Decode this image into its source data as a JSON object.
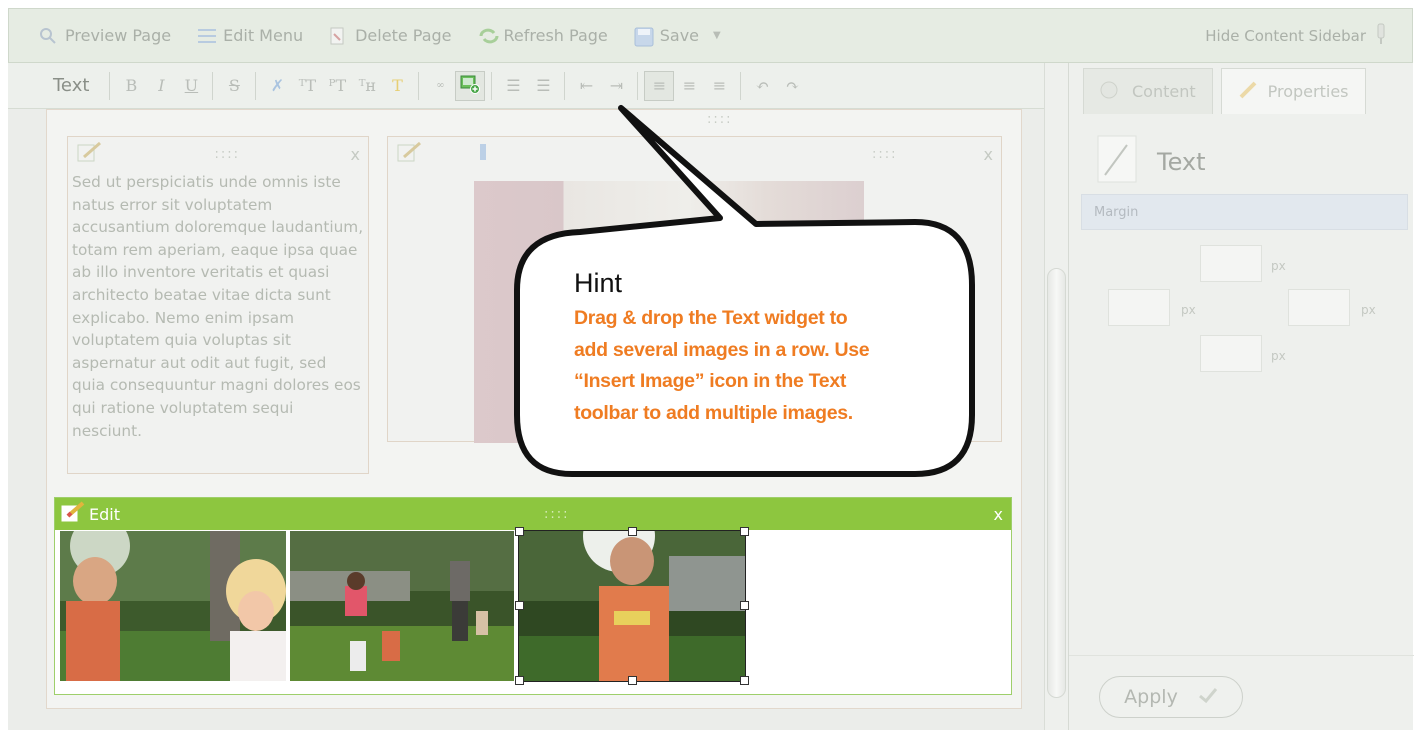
{
  "toolbar": {
    "preview_label": "Preview Page",
    "edit_menu_label": "Edit Menu",
    "delete_label": "Delete Page",
    "refresh_label": "Refresh Page",
    "save_label": "Save",
    "hide_sidebar_label": "Hide Content Sidebar"
  },
  "editor_toolbar": {
    "mode_label": "Text",
    "bold": "B",
    "italic": "I",
    "underline": "U",
    "strike": "S"
  },
  "widgets": {
    "text_widget_lorem": "Sed ut perspiciatis unde omnis iste natus error sit voluptatem accusantium doloremque laudantium, totam rem aperiam, eaque ipsa quae ab illo inventore veritatis et quasi architecto beatae vitae dicta sunt explicabo. Nemo enim ipsam voluptatem quia voluptas sit aspernatur aut odit aut fugit, sed quia consequuntur magni dolores eos qui ratione voluptatem sequi nesciunt.",
    "edit_label": "Edit",
    "close_glyph": "x",
    "drag_dots": "::::"
  },
  "sidebar": {
    "tab_content": "Content",
    "tab_properties": "Properties",
    "title": "Text",
    "margin_label": "Margin",
    "unit": "px",
    "apply_label": "Apply"
  },
  "hint": {
    "title": "Hint",
    "lines": [
      "Drag & drop the Text widget to",
      "add several images in a row. Use",
      "“Insert Image” icon in the Text",
      "toolbar to add multiple images."
    ]
  },
  "colors": {
    "accent_green": "#8dc63f",
    "hint_orange": "#ef7c22"
  }
}
